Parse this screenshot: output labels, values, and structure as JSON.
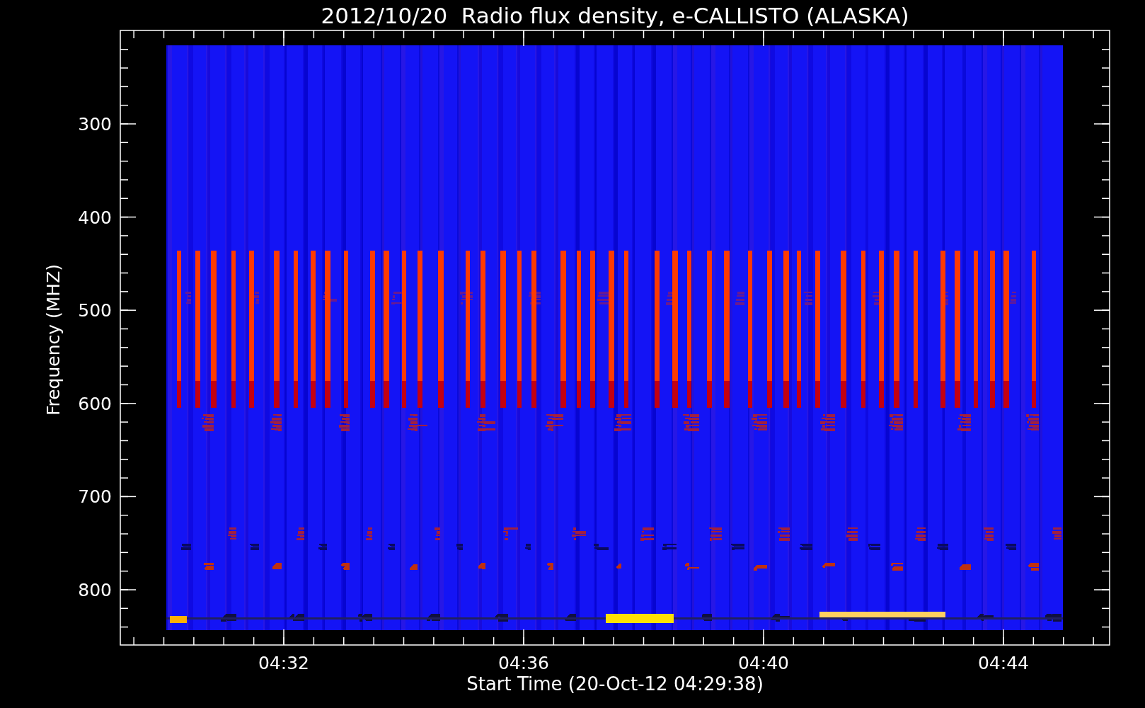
{
  "title": "2012/10/20  Radio flux density, e-CALLISTO (ALASKA)",
  "y_axis": {
    "label": "Frequency (MHZ)",
    "ticks": [
      "300",
      "400",
      "500",
      "600",
      "700",
      "800"
    ]
  },
  "x_axis": {
    "label": "Start Time (20-Oct-12 04:29:38)",
    "ticks": [
      "04:32",
      "04:36",
      "04:40",
      "04:44"
    ]
  }
}
